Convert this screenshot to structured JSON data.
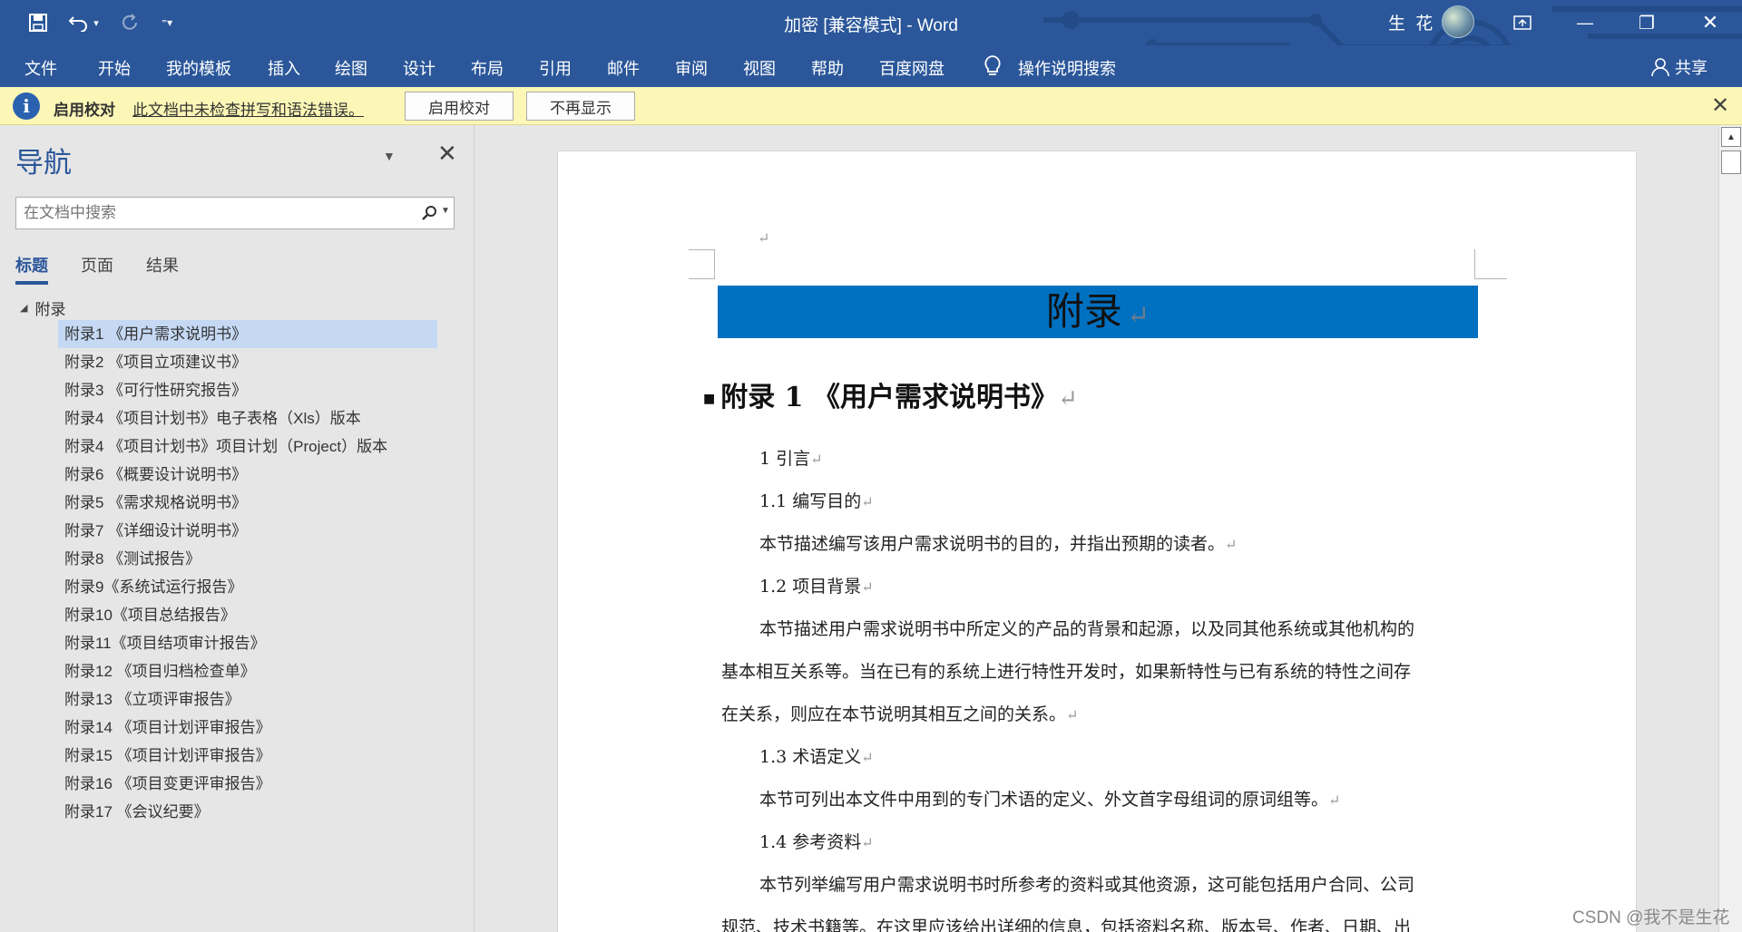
{
  "window": {
    "title": "加密 [兼容模式]  -  Word",
    "user_name": "生 花",
    "minimize": "—",
    "restore": "❐",
    "close": "✕"
  },
  "quick_access": {
    "save_icon": "save-icon",
    "undo_icon": "undo-icon",
    "redo_icon": "redo-icon",
    "customize_icon": "customize-icon"
  },
  "ribbon": {
    "tabs": [
      "文件",
      "开始",
      "我的模板",
      "插入",
      "绘图",
      "设计",
      "布局",
      "引用",
      "邮件",
      "审阅",
      "视图",
      "帮助",
      "百度网盘"
    ],
    "tell_me": "操作说明搜索",
    "share": "共享"
  },
  "message_bar": {
    "title": "启用校对",
    "message": "此文档中未检查拼写和语法错误。",
    "enable_button": "启用校对",
    "dismiss_button": "不再显示",
    "close": "✕"
  },
  "navigation": {
    "title": "导航",
    "search_placeholder": "在文档中搜索",
    "tabs": [
      "标题",
      "页面",
      "结果"
    ],
    "active_tab": "标题",
    "root": "附录",
    "headings": [
      "附录1 《用户需求说明书》",
      "附录2 《项目立项建议书》",
      "附录3 《可行性研究报告》",
      "附录4 《项目计划书》电子表格（Xls）版本",
      "附录4 《项目计划书》项目计划（Project）版本",
      "附录6 《概要设计说明书》",
      "附录5 《需求规格说明书》",
      "附录7 《详细设计说明书》",
      "附录8 《测试报告》",
      "附录9《系统试运行报告》",
      "附录10《项目总结报告》",
      "附录11《项目结项审计报告》",
      "附录12 《项目归档检查单》",
      "附录13 《立项评审报告》",
      "附录14 《项目计划评审报告》",
      "附录15 《项目计划评审报告》",
      "附录16 《项目变更评审报告》",
      "附录17 《会议纪要》"
    ],
    "selected_heading": "附录1 《用户需求说明书》"
  },
  "document": {
    "para_mark": "↵",
    "banner": "附录",
    "heading1": "附录 1 《用户需求说明书》",
    "s1": "1  引言",
    "s11": "1.1  编写目的",
    "p11": "本节描述编写该用户需求说明书的目的，并指出预期的读者。",
    "s12": "1.2  项目背景",
    "p12_l1": "本节描述用户需求说明书中所定义的产品的背景和起源，以及同其他系统或其他机构的",
    "p12_l2": "基本相互关系等。当在已有的系统上进行特性开发时，如果新特性与已有系统的特性之间存",
    "p12_l3": "在关系，则应在本节说明其相互之间的关系。",
    "s13": "1.3  术语定义",
    "p13": "本节可列出本文件中用到的专门术语的定义、外文首字母组词的原词组等。",
    "s14": "1.4  参考资料",
    "p14_l1": "本节列举编写用户需求说明书时所参考的资料或其他资源，这可能包括用户合同、公司",
    "p14_l2": "规范、技术书籍等。在这里应该给出详细的信息，包括资料名称、版本号、作者、日期、出"
  },
  "watermark": "CSDN @我不是生花",
  "colors": {
    "ribbon": "#2b579a",
    "banner": "#0070c0",
    "message_bar": "#fcf7b6",
    "selection": "#c5d9f4"
  }
}
